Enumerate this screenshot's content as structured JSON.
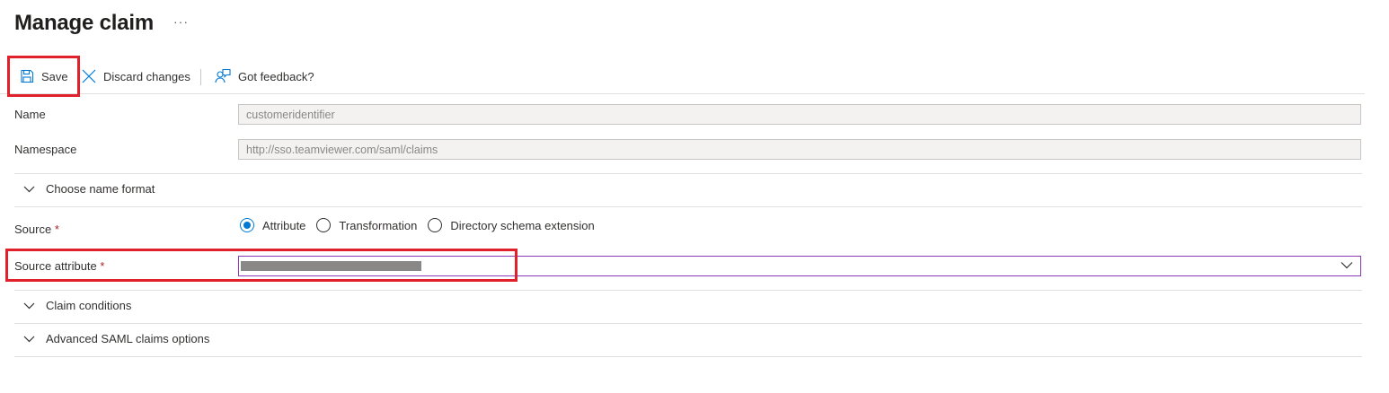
{
  "page": {
    "title": "Manage claim",
    "more_label": "···"
  },
  "toolbar": {
    "save_label": "Save",
    "discard_label": "Discard changes",
    "feedback_label": "Got feedback?"
  },
  "form": {
    "name_label": "Name",
    "name_value": "customeridentifier",
    "namespace_label": "Namespace",
    "namespace_value": "http://sso.teamviewer.com/saml/claims",
    "name_format_label": "Choose name format",
    "source_label": "Source",
    "required_mark": "*",
    "source_options": [
      "Attribute",
      "Transformation",
      "Directory schema extension"
    ],
    "source_selected": "Attribute",
    "source_attribute_label": "Source attribute",
    "source_attribute_value": "",
    "claim_conditions_label": "Claim conditions",
    "advanced_label": "Advanced SAML claims options"
  },
  "colors": {
    "accent": "#0078d4",
    "highlight": "#e0202a",
    "required": "#a4262c"
  }
}
